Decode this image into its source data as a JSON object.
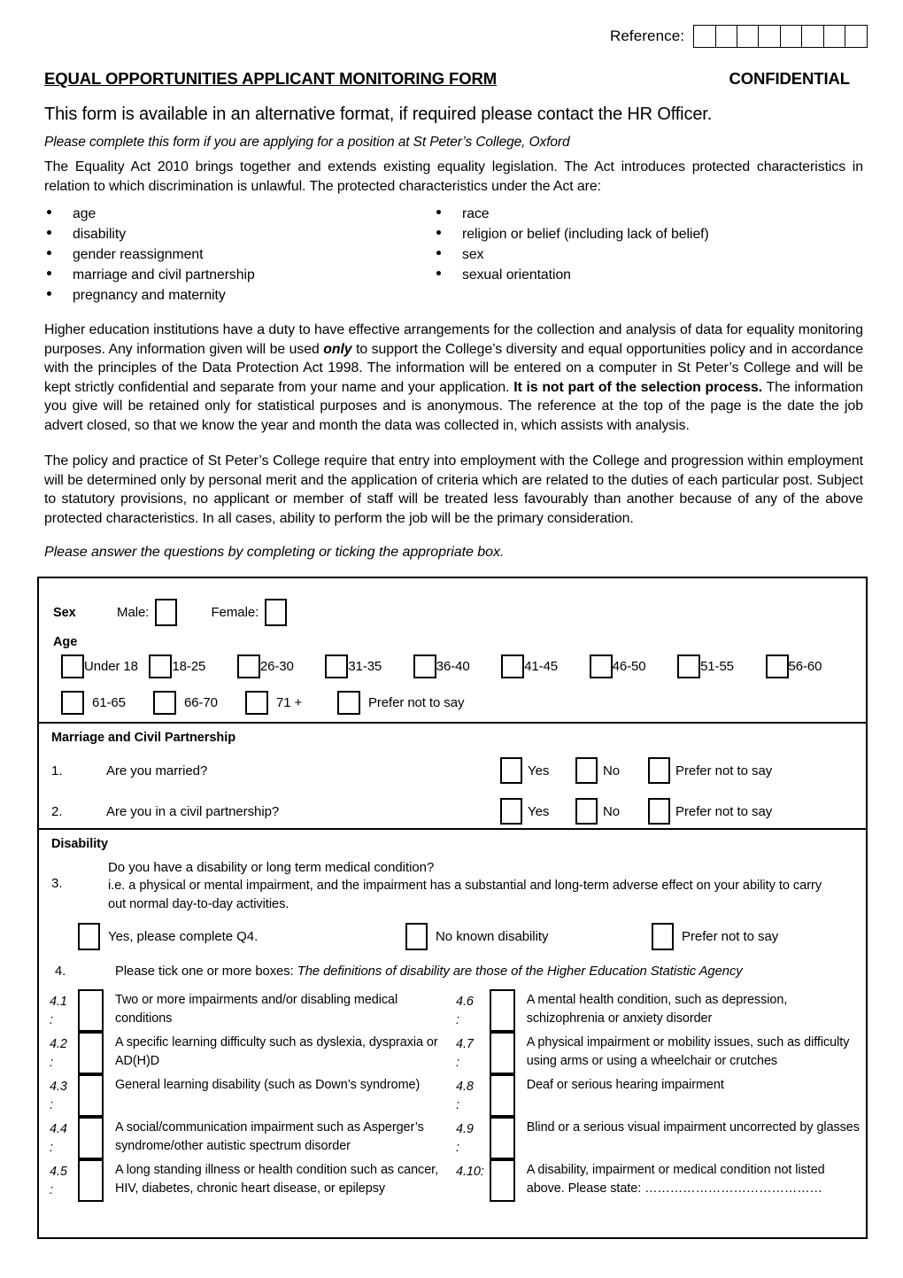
{
  "header": {
    "reference_label": "Reference:",
    "reference_box_count": 8,
    "title": "EQUAL OPPORTUNITIES APPLICANT MONITORING FORM",
    "confidential": "CONFIDENTIAL",
    "alt_format": "This form is available in an alternative format, if required please contact the HR Officer.",
    "please_complete": "Please complete this form if you are applying for a position at St Peter’s College, Oxford"
  },
  "intro": {
    "equality_act": "The Equality Act 2010 brings together and extends existing equality legislation. The Act introduces protected characteristics in relation to which discrimination is unlawful. The protected characteristics under the Act are:",
    "characteristics_left": [
      "age",
      "disability",
      "gender reassignment",
      "marriage and civil partnership",
      "pregnancy and maternity"
    ],
    "characteristics_right": [
      "race",
      "religion or belief (including lack of belief)",
      "sex",
      "sexual orientation"
    ],
    "higher_education_1": "Higher education institutions have a duty to have effective arrangements for the collection and analysis of data for equality monitoring purposes. Any information given will be used ",
    "higher_education_only": "only",
    "higher_education_2": " to support the College’s diversity and equal opportunities policy and in accordance with the principles of the Data Protection Act 1998. The information will be entered on a computer in St Peter’s College and will be kept strictly confidential and separate from your name and your application. ",
    "higher_education_bold": "It is not part of the selection process.",
    "higher_education_3": " The information you give will be retained only for statistical purposes and is anonymous. The reference at the top of the page is the date the job advert closed, so that we know the year and month the data was collected in, which assists with analysis.",
    "policy": "The policy and practice of St Peter’s College require that entry into employment with the College and progression within employment will be determined only by personal merit and the application of criteria which are related to the duties of each particular post. Subject to statutory provisions, no applicant or member of staff will be treated less favourably than another because of any of the above protected characteristics. In all cases, ability to perform the job will be the primary consideration.",
    "answer_note": "Please answer the questions by completing or ticking the appropriate box."
  },
  "sex_age": {
    "sex_label": "Sex",
    "male_label": "Male:",
    "female_label": "Female:",
    "age_label": "Age",
    "age_row1": [
      "Under 18",
      "18-25",
      "26-30",
      "31-35",
      "36-40",
      "41-45",
      "46-50",
      "51-55",
      "56-60"
    ],
    "age_row2": [
      "61-65",
      "66-70",
      "71 +",
      "Prefer not to say"
    ]
  },
  "marriage": {
    "heading": "Marriage and Civil Partnership",
    "questions": [
      {
        "num": "1.",
        "text": "Are you married?",
        "yes": "Yes",
        "no": "No",
        "pnts": "Prefer not to say"
      },
      {
        "num": "2.",
        "text": "Are you in a civil partnership?",
        "yes": "Yes",
        "no": "No",
        "pnts": "Prefer not to say"
      }
    ]
  },
  "disability": {
    "heading": "Disability",
    "q3_num": "3.",
    "q3_line1": "Do you have a disability or long term medical condition?",
    "q3_line2": "i.e. a physical or mental impairment, and the impairment has a substantial and long-term adverse effect on your ability to carry out normal day-to-day activities.",
    "q3_options": [
      "Yes, please complete Q4.",
      "No known disability",
      "Prefer not to say"
    ],
    "q4_num": "4.",
    "q4_instruction": "Please tick one or more boxes: ",
    "q4_instruction_italic": "The definitions of disability are those of the Higher Education Statistic Agency",
    "q4_left": [
      {
        "num": "4.1",
        "colon": ":",
        "text": "Two or more impairments and/or disabling medical conditions"
      },
      {
        "num": "4.2",
        "colon": ":",
        "text": "A specific learning difficulty such as dyslexia, dyspraxia or AD(H)D"
      },
      {
        "num": "4.3",
        "colon": ":",
        "text": "General learning disability (such as Down’s syndrome)"
      },
      {
        "num": "4.4",
        "colon": ":",
        "text": "A social/communication impairment such as Asperger’s syndrome/other autistic spectrum disorder"
      },
      {
        "num": "4.5",
        "colon": ":",
        "text": "A long standing illness or health condition such as cancer, HIV, diabetes, chronic heart disease, or epilepsy"
      }
    ],
    "q4_right": [
      {
        "num": "4.6",
        "colon": ":",
        "text": "A mental health condition, such as depression, schizophrenia or anxiety disorder"
      },
      {
        "num": "4.7",
        "colon": ":",
        "text": "A physical impairment or mobility issues, such as difficulty using arms or using a wheelchair or crutches"
      },
      {
        "num": "4.8",
        "colon": ":",
        "text": "Deaf or serious hearing impairment"
      },
      {
        "num": "4.9",
        "colon": ":",
        "text": "Blind or a serious visual impairment uncorrected by glasses"
      },
      {
        "num": "4.10:",
        "colon": "",
        "text": "A disability, impairment or medical condition not listed above.  Please state: ……………………………………"
      }
    ]
  },
  "colors": {
    "ink": "#000000",
    "paper": "#ffffff"
  }
}
